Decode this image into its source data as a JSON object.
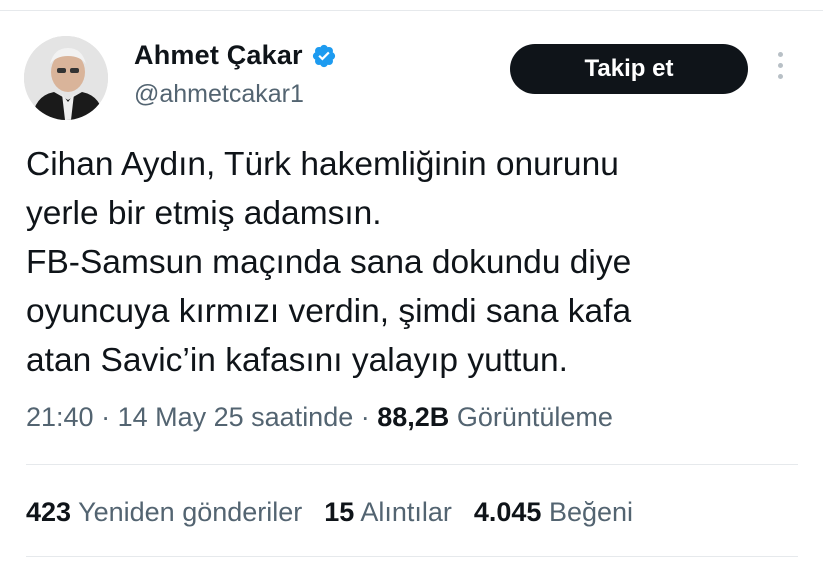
{
  "author": {
    "display_name": "Ahmet Çakar",
    "handle": "@ahmetcakar1",
    "verified": true,
    "verified_color": "#1d9bf0"
  },
  "follow_button": {
    "label": "Takip et"
  },
  "more_menu": {
    "icon": "more-vertical-icon"
  },
  "tweet": {
    "lines": [
      "Cihan Aydın, Türk hakemliğinin onurunu",
      "yerle bir etmiş adamsın.",
      "FB-Samsun maçında sana dokundu diye",
      "oyuncuya kırmızı verdin, şimdi sana kafa",
      "atan Savic’in kafasını yalayıp yuttun."
    ]
  },
  "meta": {
    "time": "21:40",
    "separator": " · ",
    "date": "14 May 25 saatinde",
    "views_count": "88,2B",
    "views_label": "Görüntüleme"
  },
  "stats": {
    "reposts_count": "423",
    "reposts_label": "Yeniden gönderiler",
    "quotes_count": "15",
    "quotes_label": "Alıntılar",
    "likes_count": "4.045",
    "likes_label": "Beğeni"
  }
}
